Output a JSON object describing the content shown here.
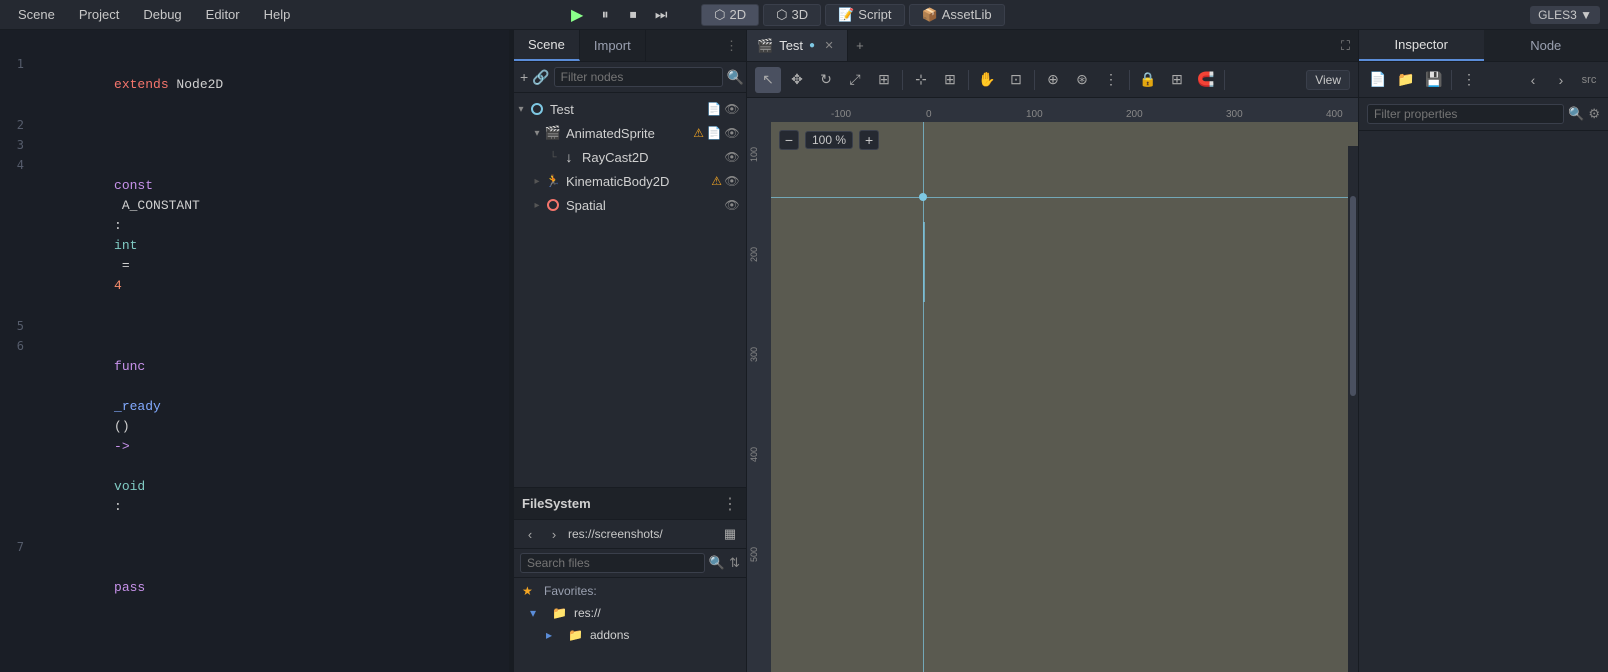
{
  "menubar": {
    "items": [
      "Scene",
      "Project",
      "Debug",
      "Editor",
      "Help"
    ],
    "modes": [
      {
        "label": "2D",
        "icon": "⬡",
        "active": true
      },
      {
        "label": "3D",
        "icon": "⬡",
        "active": false
      }
    ],
    "script_label": "Script",
    "assetlib_label": "AssetLib",
    "gles_label": "GLES3 ▼"
  },
  "code_panel": {
    "lines": [
      {
        "num": "",
        "content": "",
        "parts": []
      },
      {
        "num": "1",
        "content": "extends Node2D",
        "parts": [
          {
            "text": "extends",
            "class": "kw-red"
          },
          {
            "text": " Node2D",
            "class": "kw-normal"
          }
        ]
      },
      {
        "num": "2",
        "content": "",
        "parts": []
      },
      {
        "num": "3",
        "content": "",
        "parts": []
      },
      {
        "num": "4",
        "content": "const A_CONSTANT: int = 4",
        "parts": [
          {
            "text": "const",
            "class": "kw-keyword"
          },
          {
            "text": " A_CONSTANT",
            "class": "kw-normal"
          },
          {
            "text": ": ",
            "class": "kw-normal"
          },
          {
            "text": "int",
            "class": "kw-type"
          },
          {
            "text": " = ",
            "class": "kw-normal"
          },
          {
            "text": "4",
            "class": "kw-num"
          }
        ]
      },
      {
        "num": "5",
        "content": "",
        "parts": []
      },
      {
        "num": "6",
        "content": "func _ready() -> void:",
        "parts": [
          {
            "text": "func",
            "class": "kw-keyword"
          },
          {
            "text": " _ready",
            "class": "kw-func"
          },
          {
            "text": "() ",
            "class": "kw-normal"
          },
          {
            "text": "->",
            "class": "kw-arrow"
          },
          {
            "text": " void",
            "class": "kw-type"
          },
          {
            "text": ":",
            "class": "kw-normal"
          }
        ]
      },
      {
        "num": "7",
        "content": "    pass",
        "parts": [
          {
            "text": "    ",
            "class": "kw-normal"
          },
          {
            "text": "pass",
            "class": "kw-keyword"
          }
        ]
      }
    ]
  },
  "scene_panel": {
    "tabs": [
      "Scene",
      "Import"
    ],
    "active_tab": "Scene",
    "filter_placeholder": "Filter nodes",
    "nodes": [
      {
        "id": "test",
        "label": "Test",
        "depth": 0,
        "expanded": true,
        "icon": "circle",
        "icon_color": "#7ec8e3",
        "has_script": true,
        "visible": true,
        "warning": false
      },
      {
        "id": "animated_sprite",
        "label": "AnimatedSprite",
        "depth": 1,
        "expanded": true,
        "icon": "sprite",
        "icon_color": "#aaddaa",
        "has_script": true,
        "visible": true,
        "warning": true
      },
      {
        "id": "raycast2d",
        "label": "RayCast2D",
        "depth": 2,
        "expanded": false,
        "icon": "arrow_down",
        "icon_color": "#d0d0d0",
        "has_script": false,
        "visible": true,
        "warning": false
      },
      {
        "id": "kinematicbody2d",
        "label": "KinematicBody2D",
        "depth": 1,
        "expanded": false,
        "icon": "kinematic",
        "icon_color": "#aaddaa",
        "has_script": false,
        "visible": true,
        "warning": true
      },
      {
        "id": "spatial",
        "label": "Spatial",
        "depth": 1,
        "expanded": false,
        "icon": "circle_red",
        "icon_color": "#f5756c",
        "has_script": false,
        "visible": true,
        "warning": false
      }
    ]
  },
  "filesystem_panel": {
    "title": "FileSystem",
    "path": "res://screenshots/",
    "search_placeholder": "Search files",
    "favorites_label": "Favorites:",
    "items": [
      {
        "label": "res://",
        "type": "folder",
        "expanded": true,
        "depth": 0
      },
      {
        "label": "addons",
        "type": "folder",
        "expanded": false,
        "depth": 1
      }
    ]
  },
  "viewport": {
    "tabs": [
      {
        "label": "Test",
        "active": true,
        "modified": true
      }
    ],
    "zoom": "100 %",
    "tools": [
      "select",
      "move",
      "rotate",
      "scale",
      "frame",
      "snap",
      "pan",
      "pointer"
    ],
    "view_label": "View"
  },
  "inspector": {
    "tabs": [
      "Inspector",
      "Node"
    ],
    "active_tab": "Inspector",
    "filter_placeholder": "Filter properties"
  }
}
